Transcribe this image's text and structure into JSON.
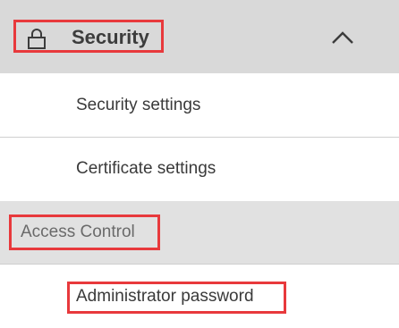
{
  "security_section": {
    "title": "Security",
    "icon": "lock-icon",
    "toggle_icon": "chevron-up-icon",
    "expanded": true,
    "items": [
      {
        "label": "Security settings"
      },
      {
        "label": "Certificate settings"
      }
    ]
  },
  "access_control": {
    "label": "Access Control",
    "items": [
      {
        "label": "Administrator password"
      }
    ]
  },
  "colors": {
    "header_bg": "#d9d9d9",
    "subgroup_bg": "#e1e1e1",
    "highlight": "#e8393c"
  }
}
